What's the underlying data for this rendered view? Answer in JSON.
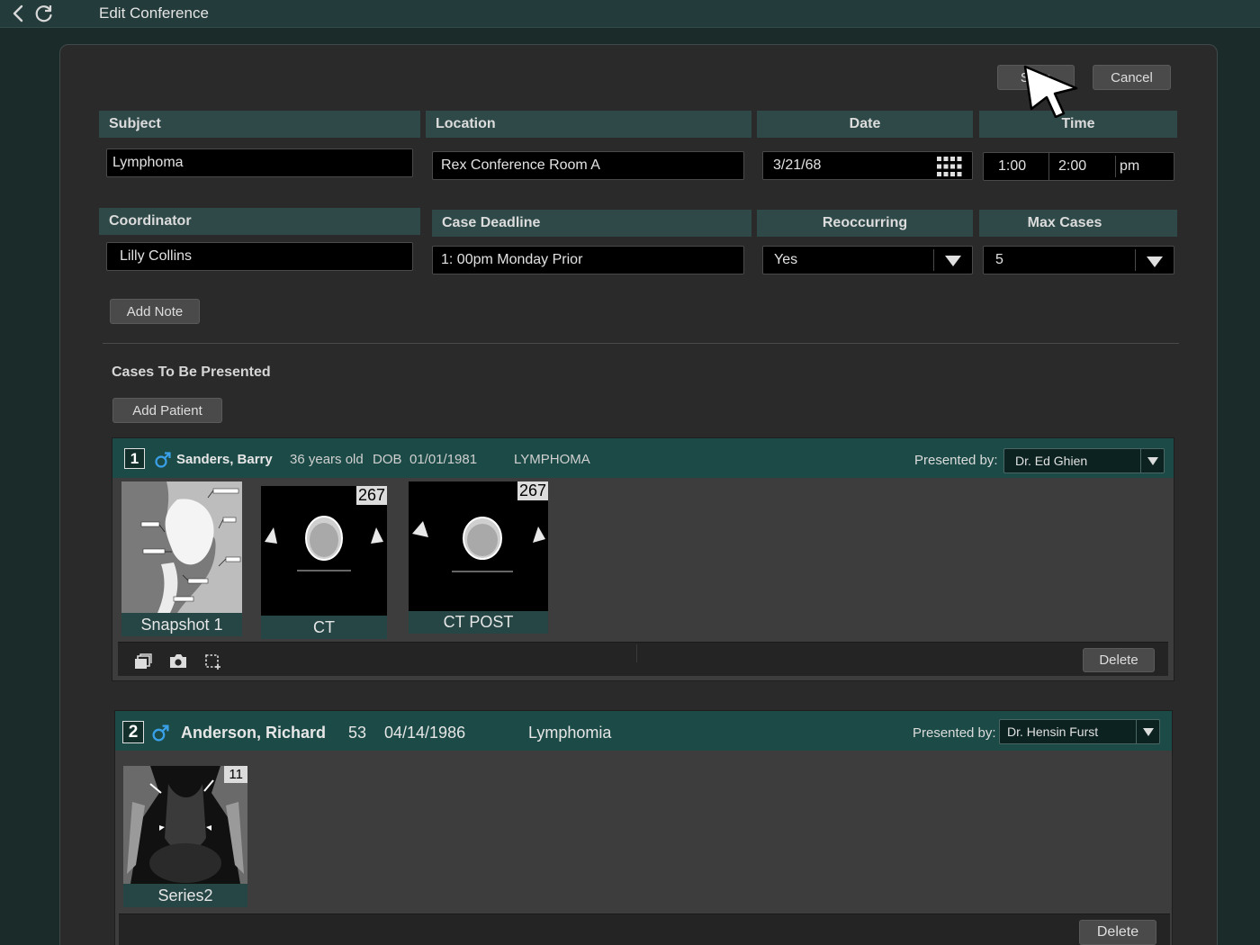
{
  "window": {
    "title": "Edit Conference"
  },
  "actions": {
    "save_label": "Save",
    "cancel_label": "Cancel"
  },
  "form": {
    "subject": {
      "label": "Subject",
      "value": "Lymphoma"
    },
    "location": {
      "label": "Location",
      "value": "Rex Conference Room A"
    },
    "date": {
      "label": "Date",
      "value": "3/21/68"
    },
    "time": {
      "label": "Time",
      "start": "1:00",
      "end": "2:00",
      "ampm": "pm"
    },
    "coordinator": {
      "label": "Coordinator",
      "value": "Lilly Collins"
    },
    "case_deadline": {
      "label": "Case Deadline",
      "value": "1: 00pm  Monday Prior"
    },
    "reoccurring": {
      "label": "Reoccurring",
      "value": "Yes"
    },
    "max_cases": {
      "label": "Max Cases",
      "value": "5"
    },
    "add_note_label": "Add Note"
  },
  "cases_section": {
    "title": "Cases To Be Presented",
    "add_patient_label": "Add Patient",
    "presented_by_label": "Presented by:",
    "delete_label": "Delete",
    "cases": [
      {
        "number": "1",
        "name": "Sanders, Barry",
        "age": "36 years old",
        "dob_label": "DOB",
        "dob": "01/01/1981",
        "diagnosis": "LYMPHOMA",
        "presenter": "Dr. Ed Ghien",
        "thumbnails": [
          {
            "caption": "Snapshot 1",
            "badge": ""
          },
          {
            "caption": "CT",
            "badge": "267"
          },
          {
            "caption": "CT POST",
            "badge": "267"
          }
        ]
      },
      {
        "number": "2",
        "name": "Anderson, Richard",
        "age": "53",
        "dob": "04/14/1986",
        "diagnosis": "Lymphomia",
        "presenter": "Dr. Hensin Furst",
        "thumbnails": [
          {
            "caption": "Series2",
            "badge": "11"
          }
        ]
      }
    ]
  },
  "icons": {
    "back": "chevron-left-icon",
    "refresh": "refresh-icon",
    "calendar": "calendar-grid-icon",
    "dropdown": "triangle-down-icon",
    "male": "male-symbol-icon",
    "series": "series-stack-icon",
    "camera": "camera-icon",
    "region": "region-select-icon",
    "cursor": "mouse-pointer-icon"
  },
  "colors": {
    "header_teal": "#1c4b47",
    "label_teal": "#2e4948",
    "male_blue": "#3aa0e8",
    "background": "#1b2b2a"
  }
}
